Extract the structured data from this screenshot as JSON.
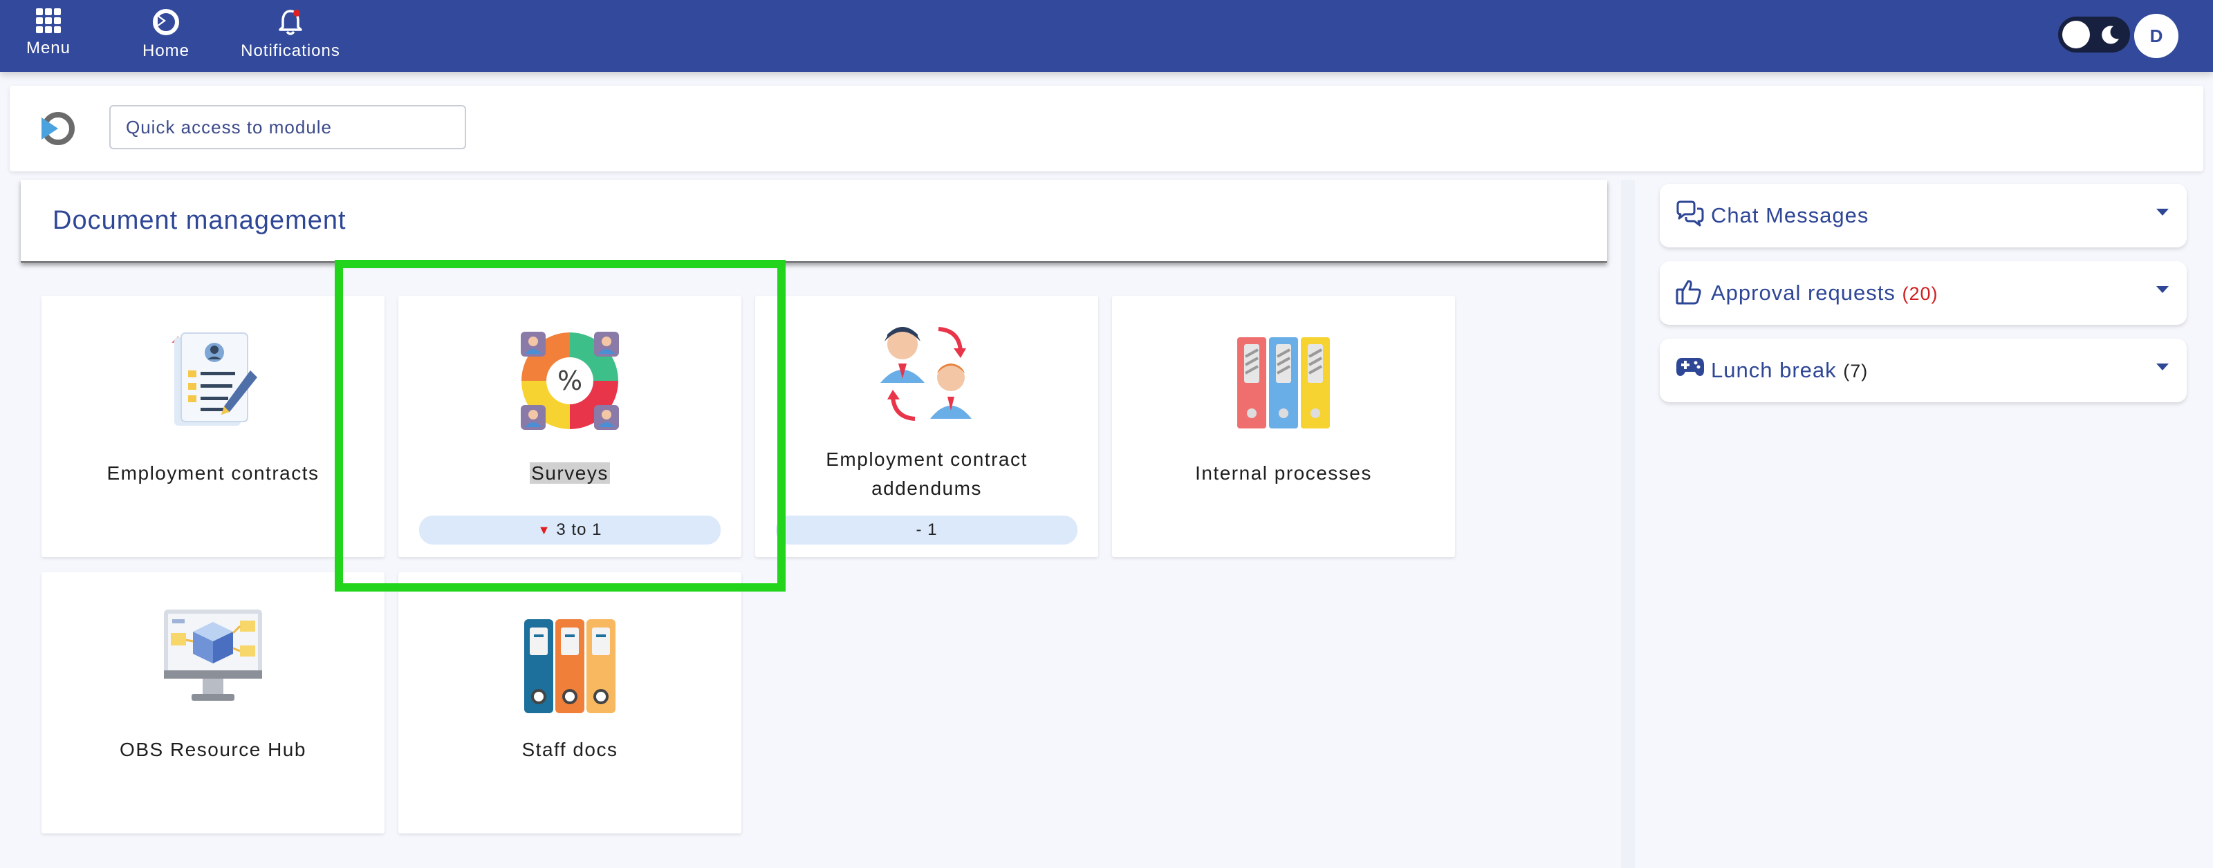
{
  "topbar": {
    "menu_label": "Menu",
    "home_label": "Home",
    "notifications_label": "Notifications",
    "avatar_initial": "D"
  },
  "quick_access": {
    "placeholder": "Quick access to module"
  },
  "section": {
    "title": "Document management"
  },
  "modules": [
    {
      "label": "Employment contracts",
      "icon": "contract-document-icon"
    },
    {
      "label": "Surveys",
      "icon": "survey-icon",
      "badge": "3 to 1"
    },
    {
      "label": "Employment contract addendums",
      "icon": "contract-exchange-icon",
      "badge": "- 1"
    },
    {
      "label": "Internal processes",
      "icon": "binders-icon"
    },
    {
      "label": "OBS Resource Hub",
      "icon": "monitor-cube-icon"
    },
    {
      "label": "Staff docs",
      "icon": "folders-icon"
    }
  ],
  "panels": [
    {
      "label": "Chat Messages",
      "icon": "chat-icon"
    },
    {
      "label": "Approval requests",
      "count": "(20)",
      "icon": "thumbs-up-icon"
    },
    {
      "label": "Lunch break",
      "count": "(7)",
      "icon": "gamepad-icon"
    }
  ],
  "colors": {
    "topbar": "#334a9c",
    "accent_text": "#2e4696",
    "highlight": "#22d41c",
    "badge_bg": "#dbe9fb",
    "alert_red": "#d11e1e"
  }
}
